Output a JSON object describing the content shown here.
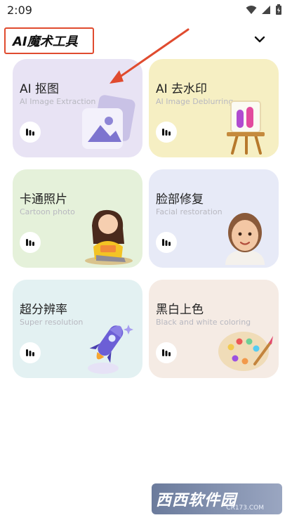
{
  "status_bar": {
    "time": "2:09"
  },
  "header": {
    "title": "AI魔术工具"
  },
  "cards": [
    {
      "title": "AI 抠图",
      "subtitle": "AI Image Extraction"
    },
    {
      "title": "AI 去水印",
      "subtitle": "AI Image Deblurring"
    },
    {
      "title": "卡通照片",
      "subtitle": "Cartoon photo"
    },
    {
      "title": "脸部修复",
      "subtitle": "Facial restoration"
    },
    {
      "title": "超分辨率",
      "subtitle": "Super resolution"
    },
    {
      "title": "黑白上色",
      "subtitle": "Black and white coloring"
    }
  ],
  "watermark": {
    "text": "西西软件园",
    "domain": "CR173.COM"
  },
  "colors": {
    "accent_red": "#e04b2f",
    "card_purple": "#e8e3f4",
    "card_yellow": "#f6efc3",
    "card_green": "#e5f1da",
    "card_blue": "#e7eaf7",
    "card_cyan": "#e3f1f2",
    "card_peach": "#f5ebe4"
  }
}
